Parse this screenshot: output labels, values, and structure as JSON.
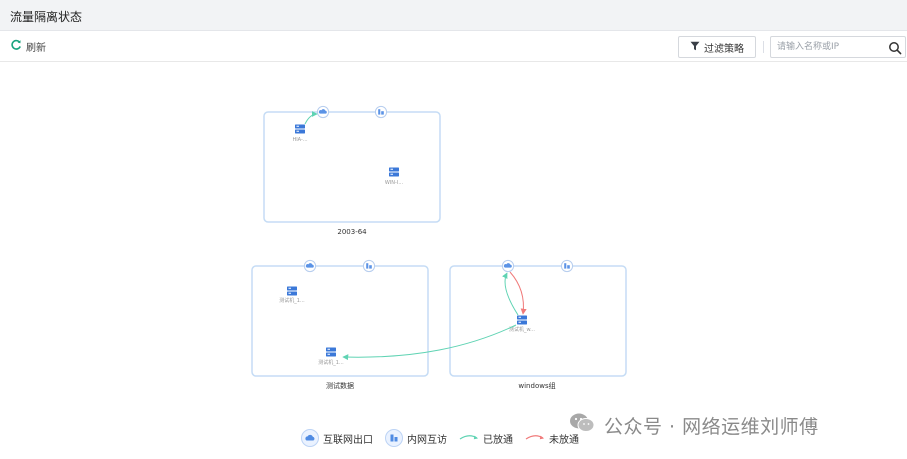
{
  "page": {
    "title": "流量隔离状态"
  },
  "toolbar": {
    "refresh_label": "刷新",
    "filter_label": "过滤策略",
    "search_placeholder": "请输入名称或IP"
  },
  "groups": [
    {
      "name": "2003-64",
      "hosts": [
        "HIA-...",
        "WIN-I..."
      ]
    },
    {
      "name": "测试数据",
      "hosts": [
        "测试机_1...",
        "测试机_1..."
      ]
    },
    {
      "name": "windows组",
      "hosts": [
        "测试机_w..."
      ]
    }
  ],
  "legend": {
    "internet_exit": "互联网出口",
    "intranet": "内网互访",
    "allowed": "已放通",
    "not_allowed": "未放通"
  },
  "colors": {
    "allowed": "#5fd3b3",
    "not_allowed": "#f07a7a",
    "group_border": "#c5dcf5",
    "accent": "#2f6fd8"
  },
  "watermark": {
    "text": "公众号 · 网络运维刘师傅"
  }
}
